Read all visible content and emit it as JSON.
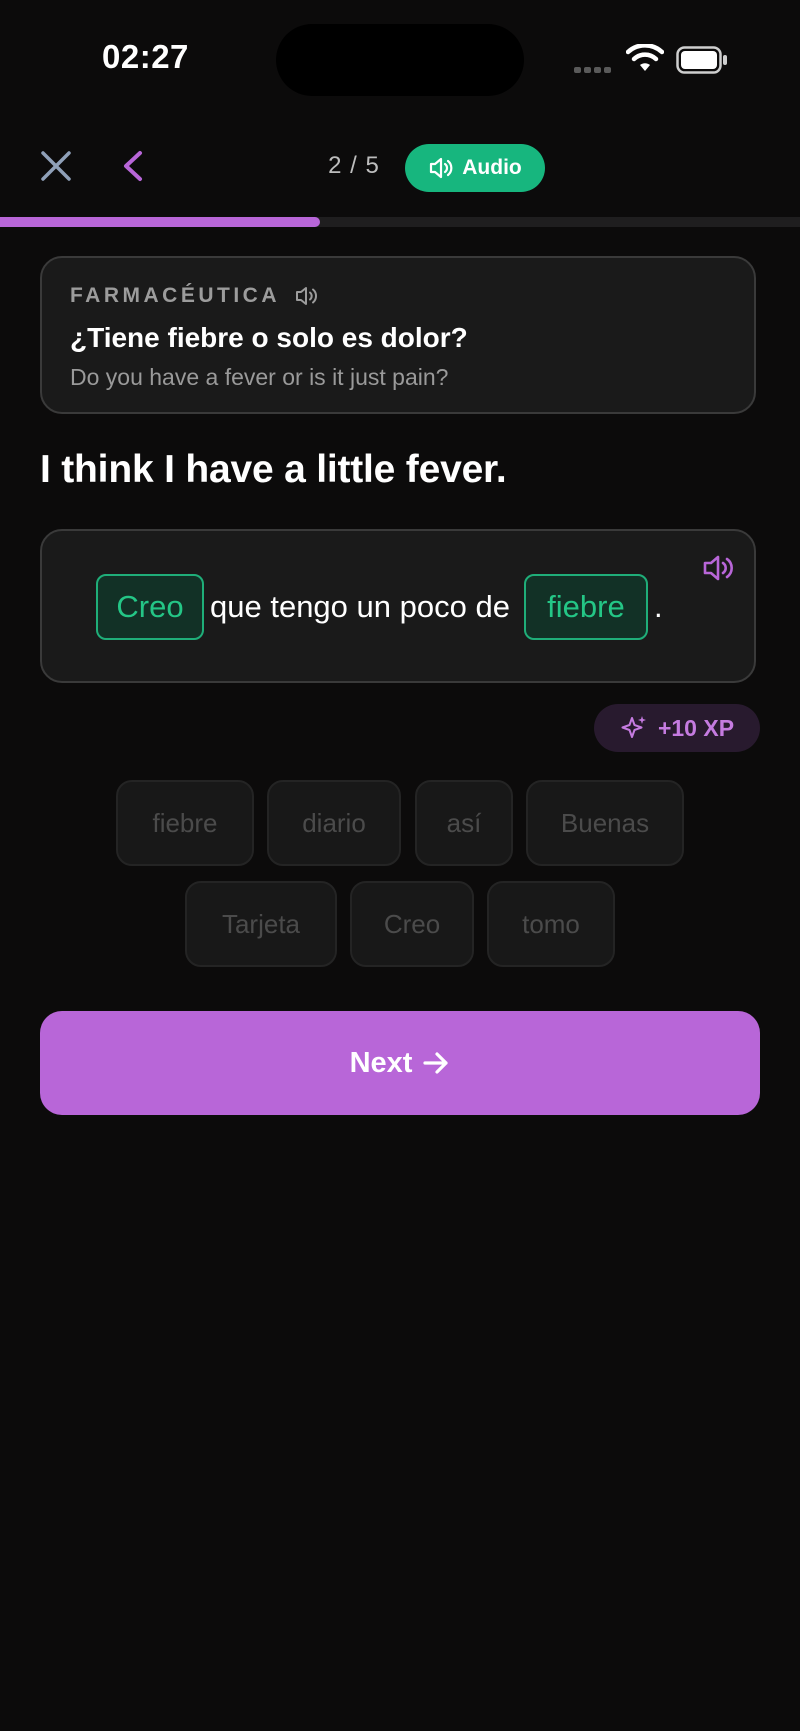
{
  "status_bar": {
    "time": "02:27"
  },
  "header": {
    "progress_text": "2 / 5",
    "progress_fraction": 0.4,
    "audio_label": "Audio"
  },
  "context": {
    "label": "FARMACÉUTICA",
    "question": "¿Tiene fiebre o solo es dolor?",
    "translation": "Do you have a fever or is it just pain?"
  },
  "prompt": "I think I have a little fever.",
  "answer": {
    "blank_1": "Creo",
    "middle_text": "que tengo un poco de",
    "blank_2": "fiebre",
    "end_punctuation": "."
  },
  "xp_badge": "+10 XP",
  "word_bank": [
    "fiebre",
    "diario",
    "así",
    "Buenas",
    "Tarjeta",
    "Creo",
    "tomo"
  ],
  "next_button": "Next",
  "colors": {
    "background": "#0c0b0b",
    "accent_purple": "#b866d8",
    "accent_green": "#17b67e",
    "card": "#1a1a1a"
  },
  "icons": {
    "close": "close-icon",
    "back": "chevron-left-icon",
    "audio": "speaker-icon",
    "xp": "sparkle-icon",
    "next": "arrow-right-icon"
  }
}
